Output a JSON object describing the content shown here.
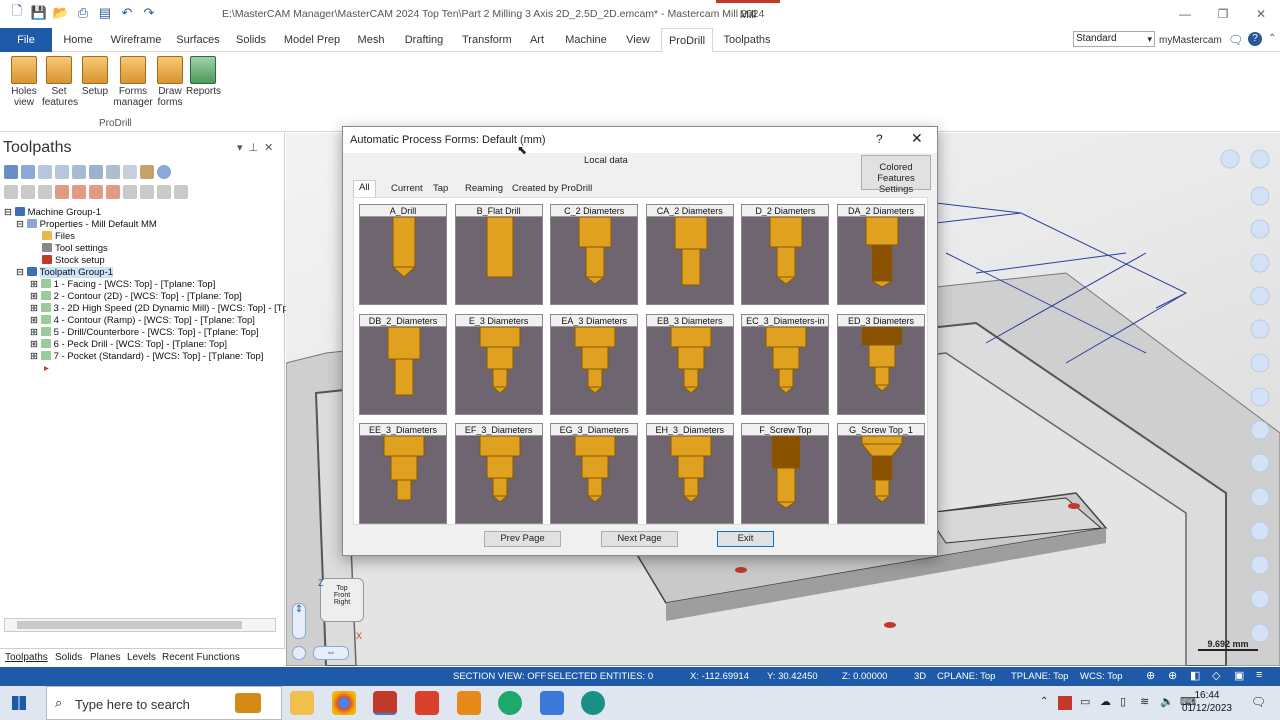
{
  "app": {
    "title": "E:\\MasterCAM Manager\\MasterCAM 2024 Top Ten\\Part 2 Milling 3 Axis 2D_2.5D_2D.emcam* - Mastercam Mill 2024",
    "context_tab": "Mill"
  },
  "tabs": [
    "File",
    "Home",
    "Wireframe",
    "Surfaces",
    "Solids",
    "Model Prep",
    "Mesh",
    "Drafting",
    "Transform",
    "Art",
    "Machine",
    "View",
    "ProDrill",
    "Toolpaths"
  ],
  "display_mode": "Standard",
  "my_mastercam": "myMastercam",
  "ribbon": {
    "buttons": [
      "Holes view",
      "Set features",
      "Setup",
      "Forms manager",
      "Draw forms",
      "Reports"
    ],
    "group": "ProDrill"
  },
  "panel": {
    "title": "Toolpaths",
    "bottom_tabs": [
      "Toolpaths",
      "Solids",
      "Planes",
      "Levels",
      "Recent Functions"
    ]
  },
  "tree": [
    {
      "text": "Machine Group-1",
      "indent": 0,
      "icon": "machine-icon"
    },
    {
      "text": "Properties - Mill Default MM",
      "indent": 1,
      "icon": "properties-icon"
    },
    {
      "text": "Files",
      "indent": 2,
      "icon": "folder-icon"
    },
    {
      "text": "Tool settings",
      "indent": 2,
      "icon": "tool-icon"
    },
    {
      "text": "Stock setup",
      "indent": 2,
      "icon": "stock-icon"
    },
    {
      "text": "Toolpath Group-1",
      "indent": 1,
      "icon": "toolpath-group-icon",
      "selected": true
    },
    {
      "text": "1 - Facing - [WCS: Top] - [Tplane: Top]",
      "indent": 2,
      "icon": "op-icon"
    },
    {
      "text": "2 - Contour (2D) - [WCS: Top] - [Tplane: Top]",
      "indent": 2,
      "icon": "op-icon"
    },
    {
      "text": "3 - 2D High Speed (2D Dynamic Mill) - [WCS: Top] - [Tpla",
      "indent": 2,
      "icon": "op-icon"
    },
    {
      "text": "4 - Contour (Ramp) - [WCS: Top] - [Tplane: Top]",
      "indent": 2,
      "icon": "op-icon"
    },
    {
      "text": "5 - Drill/Counterbore - [WCS: Top] - [Tplane: Top]",
      "indent": 2,
      "icon": "op-icon"
    },
    {
      "text": "6 - Peck Drill - [WCS: Top] - [Tplane: Top]",
      "indent": 2,
      "icon": "op-icon"
    },
    {
      "text": "7 - Pocket (Standard) - [WCS: Top] - [Tplane: Top]",
      "indent": 2,
      "icon": "op-icon"
    }
  ],
  "dialog": {
    "title": "Automatic Process Forms: Default (mm)",
    "help": "?",
    "close": "✕",
    "local_data": "Local data",
    "colored_features": "Colored Features Settings",
    "tabs": [
      "All",
      "Current",
      "Tap",
      "Reaming",
      "Created by ProDrill"
    ],
    "forms": [
      {
        "name": "A_Drill",
        "type": "drill"
      },
      {
        "name": "B_Flat Drill",
        "type": "flat"
      },
      {
        "name": "C_2 Diameters",
        "type": "d2"
      },
      {
        "name": "CA_2 Diameters",
        "type": "d2flat"
      },
      {
        "name": "D_2 Diameters",
        "type": "d2"
      },
      {
        "name": "DA_2 Diameters",
        "type": "d2thread"
      },
      {
        "name": "DB_2_Diameters",
        "type": "d2flat"
      },
      {
        "name": "E_3 Diameters",
        "type": "d3"
      },
      {
        "name": "EA_3 Diameters",
        "type": "d3"
      },
      {
        "name": "EB_3 Diameters",
        "type": "d3"
      },
      {
        "name": "EC_3_Diameters-in",
        "type": "d3"
      },
      {
        "name": "ED_3 Diameters",
        "type": "d3thread"
      },
      {
        "name": "EE_3_Diameters",
        "type": "d3flat"
      },
      {
        "name": "EF_3_Diameters",
        "type": "d3"
      },
      {
        "name": "EG_3_Diameters",
        "type": "d3"
      },
      {
        "name": "EH_3_Diameters",
        "type": "d3"
      },
      {
        "name": "F_Screw Top",
        "type": "screw"
      },
      {
        "name": "G_Screw Top_1",
        "type": "screwtop"
      }
    ],
    "buttons": {
      "prev": "Prev Page",
      "next": "Next Page",
      "exit": "Exit"
    }
  },
  "viewport": {
    "scale": "9.692 mm",
    "axes": {
      "z": "Z",
      "x": "X"
    },
    "cube": {
      "top": "Top",
      "front": "Front",
      "right": "Right"
    }
  },
  "status": {
    "section_view": "SECTION VIEW: OFF",
    "selected": "SELECTED ENTITIES: 0",
    "x": "X:   -112.69914",
    "y": "Y:   30.42450",
    "z": "Z:   0.00000",
    "mode": "3D",
    "cplane": "CPLANE: Top",
    "tplane": "TPLANE: Top",
    "wcs": "WCS: Top"
  },
  "taskbar": {
    "search": "Type here to search",
    "time": "16:44",
    "date": "01/12/2023"
  }
}
